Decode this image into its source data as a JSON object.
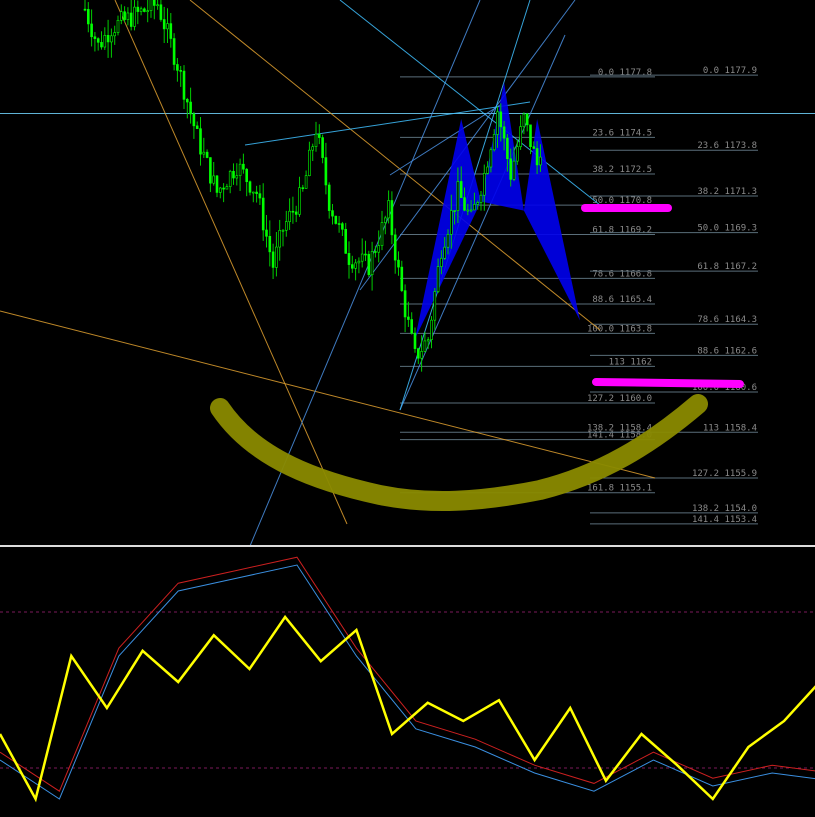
{
  "chart_data": {
    "type": "candlestick",
    "price_axis": {
      "range": [
        1152.3,
        1182.0
      ]
    },
    "horizontal_line_price": 1175.8,
    "fib_levels_left": [
      {
        "label": "0.0 1177.8",
        "price": 1177.8
      },
      {
        "label": "23.6 1174.5",
        "price": 1174.5
      },
      {
        "label": "38.2 1172.5",
        "price": 1172.5
      },
      {
        "label": "50.0 1170.8",
        "price": 1170.8
      },
      {
        "label": "61.8 1169.2",
        "price": 1169.2
      },
      {
        "label": "78.6 1166.8",
        "price": 1166.8
      },
      {
        "label": "88.6 1165.4",
        "price": 1165.4
      },
      {
        "label": "100.0 1163.8",
        "price": 1163.8
      },
      {
        "label": "113 1162",
        "price": 1162.0
      },
      {
        "label": "127.2 1160.0",
        "price": 1160.0
      },
      {
        "label": "138.2 1158.4",
        "price": 1158.4
      },
      {
        "label": "141.4 1158.0",
        "price": 1158.0
      },
      {
        "label": "161.8 1155.1",
        "price": 1155.1
      }
    ],
    "fib_levels_right": [
      {
        "label": "0.0 1177.9",
        "price": 1177.9
      },
      {
        "label": "23.6 1173.8",
        "price": 1173.8
      },
      {
        "label": "38.2 1171.3",
        "price": 1171.3
      },
      {
        "label": "50.0 1169.3",
        "price": 1169.3
      },
      {
        "label": "61.8 1167.2",
        "price": 1167.2
      },
      {
        "label": "78.6 1164.3",
        "price": 1164.3
      },
      {
        "label": "88.6 1162.6",
        "price": 1162.6
      },
      {
        "label": "100.0 1160.6",
        "price": 1160.6
      },
      {
        "label": "113 1158.4",
        "price": 1158.4
      },
      {
        "label": "127.2 1155.9",
        "price": 1155.9
      },
      {
        "label": "138.2 1154.0",
        "price": 1154.0
      },
      {
        "label": "141.4 1153.4",
        "price": 1153.4
      }
    ],
    "price_path": [
      {
        "bar": 0,
        "price": 1181.5
      },
      {
        "bar": 4,
        "price": 1179.5
      },
      {
        "bar": 8,
        "price": 1180.5
      },
      {
        "bar": 22,
        "price": 1181.8
      },
      {
        "bar": 28,
        "price": 1178.5
      },
      {
        "bar": 34,
        "price": 1174.5
      },
      {
        "bar": 40,
        "price": 1171.5
      },
      {
        "bar": 46,
        "price": 1173.0
      },
      {
        "bar": 52,
        "price": 1171.5
      },
      {
        "bar": 57,
        "price": 1167.5
      },
      {
        "bar": 60,
        "price": 1169.5
      },
      {
        "bar": 66,
        "price": 1171.5
      },
      {
        "bar": 70,
        "price": 1175.0
      },
      {
        "bar": 74,
        "price": 1171.0
      },
      {
        "bar": 80,
        "price": 1168.0
      },
      {
        "bar": 86,
        "price": 1167.5
      },
      {
        "bar": 92,
        "price": 1170.5
      },
      {
        "bar": 96,
        "price": 1166.0
      },
      {
        "bar": 100,
        "price": 1162.5
      },
      {
        "bar": 104,
        "price": 1163.5
      },
      {
        "bar": 108,
        "price": 1168.5
      },
      {
        "bar": 113,
        "price": 1171.5
      },
      {
        "bar": 117,
        "price": 1170.0
      },
      {
        "bar": 121,
        "price": 1172.5
      },
      {
        "bar": 125,
        "price": 1176.0
      },
      {
        "bar": 129,
        "price": 1172.5
      },
      {
        "bar": 133,
        "price": 1175.5
      },
      {
        "bar": 137,
        "price": 1173.0
      },
      {
        "bar": 139,
        "price": 1175.0
      }
    ],
    "harmonic_pattern_points": [
      {
        "bar": 100,
        "price": 1163.5
      },
      {
        "bar": 114,
        "price": 1175.5
      },
      {
        "bar": 120,
        "price": 1171.0
      },
      {
        "bar": 127,
        "price": 1177.5
      },
      {
        "bar": 133,
        "price": 1170.5
      },
      {
        "bar": 137,
        "price": 1175.5
      },
      {
        "bar": 150,
        "price": 1164.5
      }
    ],
    "oscillator": {
      "yellow": [
        {
          "bar": 0,
          "value": 30
        },
        {
          "bar": 3,
          "value": 5
        },
        {
          "bar": 6,
          "value": 60
        },
        {
          "bar": 9,
          "value": 40
        },
        {
          "bar": 12,
          "value": 62
        },
        {
          "bar": 15,
          "value": 50
        },
        {
          "bar": 18,
          "value": 68
        },
        {
          "bar": 21,
          "value": 55
        },
        {
          "bar": 24,
          "value": 75
        },
        {
          "bar": 27,
          "value": 58
        },
        {
          "bar": 30,
          "value": 70
        },
        {
          "bar": 33,
          "value": 30
        },
        {
          "bar": 36,
          "value": 42
        },
        {
          "bar": 39,
          "value": 35
        },
        {
          "bar": 42,
          "value": 43
        },
        {
          "bar": 45,
          "value": 20
        },
        {
          "bar": 48,
          "value": 40
        },
        {
          "bar": 51,
          "value": 12
        },
        {
          "bar": 54,
          "value": 30
        },
        {
          "bar": 57,
          "value": 18
        },
        {
          "bar": 60,
          "value": 5
        },
        {
          "bar": 63,
          "value": 25
        },
        {
          "bar": 66,
          "value": 35
        },
        {
          "bar": 69,
          "value": 50
        },
        {
          "bar": 72,
          "value": 38
        },
        {
          "bar": 74,
          "value": 60
        },
        {
          "bar": 77,
          "value": 15
        },
        {
          "bar": 80,
          "value": 50
        },
        {
          "bar": 83,
          "value": 65
        },
        {
          "bar": 86,
          "value": 80
        },
        {
          "bar": 89,
          "value": 88
        },
        {
          "bar": 92,
          "value": 40
        },
        {
          "bar": 95,
          "value": 22
        },
        {
          "bar": 98,
          "value": 30
        },
        {
          "bar": 101,
          "value": 45
        },
        {
          "bar": 104,
          "value": 68
        },
        {
          "bar": 107,
          "value": 42
        },
        {
          "bar": 110,
          "value": 30
        },
        {
          "bar": 113,
          "value": 55
        },
        {
          "bar": 116,
          "value": 80
        },
        {
          "bar": 119,
          "value": 58
        },
        {
          "bar": 122,
          "value": 75
        },
        {
          "bar": 125,
          "value": 62
        },
        {
          "bar": 128,
          "value": 82
        },
        {
          "bar": 131,
          "value": 70
        },
        {
          "bar": 134,
          "value": 55
        },
        {
          "bar": 137,
          "value": 68
        }
      ],
      "blue": [
        {
          "bar": 0,
          "value": 20
        },
        {
          "bar": 5,
          "value": 5
        },
        {
          "bar": 10,
          "value": 60
        },
        {
          "bar": 15,
          "value": 85
        },
        {
          "bar": 20,
          "value": 90
        },
        {
          "bar": 25,
          "value": 95
        },
        {
          "bar": 30,
          "value": 60
        },
        {
          "bar": 35,
          "value": 32
        },
        {
          "bar": 40,
          "value": 25
        },
        {
          "bar": 45,
          "value": 15
        },
        {
          "bar": 50,
          "value": 8
        },
        {
          "bar": 55,
          "value": 20
        },
        {
          "bar": 60,
          "value": 10
        },
        {
          "bar": 65,
          "value": 15
        },
        {
          "bar": 70,
          "value": 12
        },
        {
          "bar": 75,
          "value": 18
        },
        {
          "bar": 80,
          "value": 35
        },
        {
          "bar": 85,
          "value": 75
        },
        {
          "bar": 90,
          "value": 92
        },
        {
          "bar": 95,
          "value": 50
        },
        {
          "bar": 100,
          "value": 30
        },
        {
          "bar": 105,
          "value": 25
        },
        {
          "bar": 108,
          "value": 8
        },
        {
          "bar": 112,
          "value": 55
        },
        {
          "bar": 116,
          "value": 62
        },
        {
          "bar": 120,
          "value": 92
        },
        {
          "bar": 123,
          "value": 82
        },
        {
          "bar": 127,
          "value": 88
        },
        {
          "bar": 130,
          "value": 95
        },
        {
          "bar": 134,
          "value": 85
        },
        {
          "bar": 137,
          "value": 80
        }
      ],
      "levels": [
        80,
        20
      ]
    }
  },
  "colors": {
    "background": "#000000",
    "bull_candle": "#00ff00",
    "bear_candle": "#00ff00",
    "candle_wick": "#00cc00",
    "horizontal_line": "#5fb3d6",
    "fib_line": "#5a6e7a",
    "fib_text": "#8a8a8a",
    "trendline_blue": "#4a90e2",
    "trendline_cyan": "#40c0ff",
    "trendline_orange": "#e0a030",
    "pattern_fill": "#0000ee",
    "highlight_magenta": "#ff00ff",
    "highlight_olive": "#8a8a00",
    "osc_yellow": "#ffff00",
    "osc_blue": "#3a8fe0",
    "osc_red": "#cc2020",
    "osc_level": "#7a1a5a",
    "panel_divider": "#dddddd"
  }
}
